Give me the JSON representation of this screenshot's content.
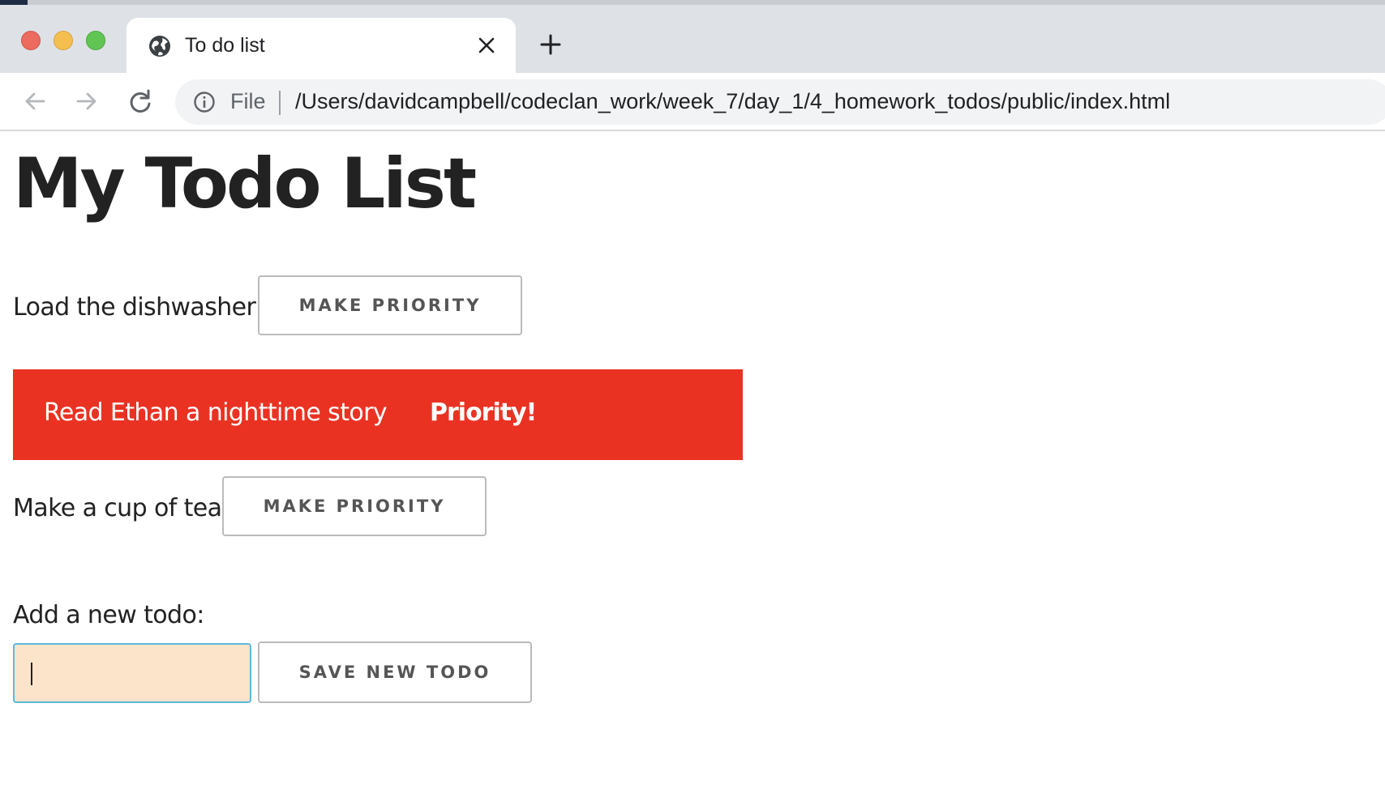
{
  "browser": {
    "tab_title": "To do list",
    "scheme_label": "File",
    "url": "/Users/davidcampbell/codeclan_work/week_7/day_1/4_homework_todos/public/index.html",
    "colors": {
      "tabstrip": "#dee1e6",
      "traffic_close": "#ed6a5e",
      "traffic_minimize": "#f5bf4f",
      "traffic_maximize": "#61c554"
    },
    "icons": [
      "globe-icon",
      "close-icon",
      "plus-icon",
      "back-arrow-icon",
      "forward-arrow-icon",
      "reload-icon",
      "info-icon"
    ]
  },
  "page": {
    "title": "My Todo List",
    "todos": [
      {
        "text": "Load the dishwasher",
        "priority": false,
        "button_label": "MAKE PRIORITY"
      },
      {
        "text": "Read Ethan a nighttime story",
        "priority": true,
        "badge": "Priority!"
      },
      {
        "text": "Make a cup of tea",
        "priority": false,
        "button_label": "MAKE PRIORITY"
      }
    ],
    "add_form": {
      "label": "Add a new todo:",
      "input_value": "",
      "save_label": "SAVE NEW TODO"
    },
    "colors": {
      "priority_background": "#ea3223",
      "input_background": "#fbe4c9",
      "input_focus_border": "#5bbbe0"
    }
  }
}
